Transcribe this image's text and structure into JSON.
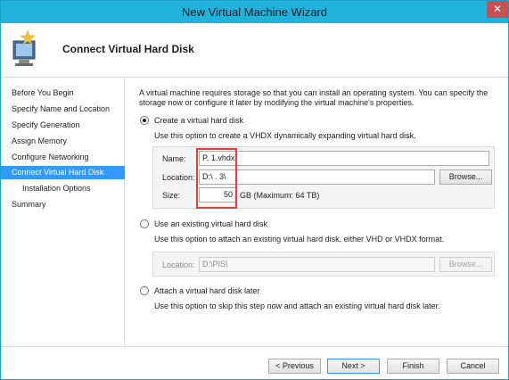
{
  "window": {
    "title": "New Virtual Machine Wizard",
    "close_glyph": "✕"
  },
  "header": {
    "title": "Connect Virtual Hard Disk",
    "icon": "virtual-machine-wizard-icon"
  },
  "nav": {
    "items": [
      {
        "label": "Before You Begin",
        "active": false,
        "sub": false
      },
      {
        "label": "Specify Name and Location",
        "active": false,
        "sub": false
      },
      {
        "label": "Specify Generation",
        "active": false,
        "sub": false
      },
      {
        "label": "Assign Memory",
        "active": false,
        "sub": false
      },
      {
        "label": "Configure Networking",
        "active": false,
        "sub": false
      },
      {
        "label": "Connect Virtual Hard Disk",
        "active": true,
        "sub": false
      },
      {
        "label": "Installation Options",
        "active": false,
        "sub": true
      },
      {
        "label": "Summary",
        "active": false,
        "sub": false
      }
    ]
  },
  "main": {
    "intro": "A virtual machine requires storage so that you can install an operating system. You can specify the storage now or configure it later by modifying the virtual machine's properties.",
    "create": {
      "label": "Create a virtual hard disk",
      "checked": true,
      "description": "Use this option to create a VHDX dynamically expanding virtual hard disk.",
      "name_label": "Name:",
      "name_value": "​P. 1.vhdx",
      "location_label": "Location:",
      "location_value": "D:\\ . 3\\",
      "browse_label": "Browse...",
      "size_label": "Size:",
      "size_value": "50",
      "size_suffix": "GB (Maximum: 64 TB)"
    },
    "existing": {
      "label": "Use an existing virtual hard disk",
      "checked": false,
      "description": "Use this option to attach an existing virtual hard disk, either VHD or VHDX format.",
      "location_label": "Location:",
      "location_value": "D:\\PIS\\",
      "browse_label": "Browse..."
    },
    "later": {
      "label": "Attach a virtual hard disk later",
      "checked": false,
      "description": "Use this option to skip this step now and attach an existing virtual hard disk later."
    }
  },
  "footer": {
    "previous_label": "< Previous",
    "next_label": "Next >",
    "finish_label": "Finish",
    "cancel_label": "Cancel"
  },
  "colors": {
    "titlebar": "#22b3dd",
    "active_nav": "#3399ff",
    "highlight": "#e53d3d",
    "close": "#c75050"
  }
}
